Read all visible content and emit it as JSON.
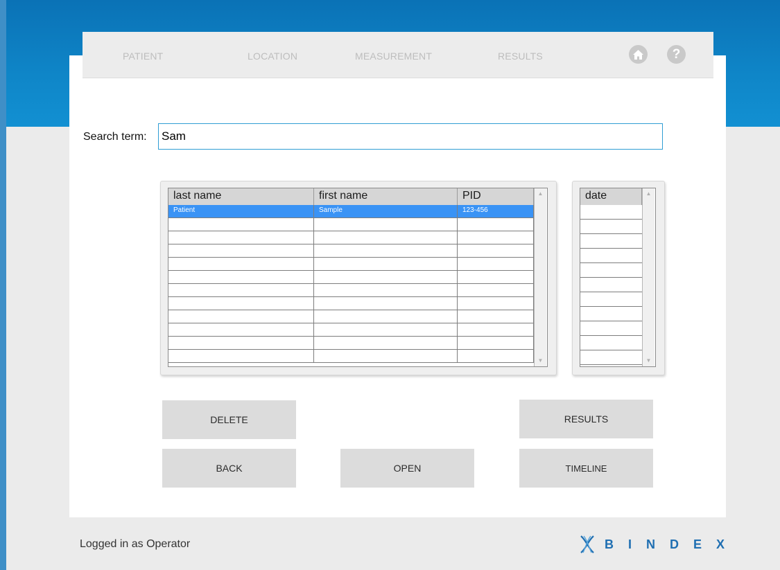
{
  "nav": {
    "items": [
      "PATIENT",
      "LOCATION",
      "MEASUREMENT",
      "RESULTS"
    ],
    "home_icon": "home-icon",
    "help_icon": "help-icon"
  },
  "search": {
    "label": "Search term:",
    "value": "Sam"
  },
  "patients": {
    "columns": [
      "last name",
      "first name",
      "PID"
    ],
    "rows": [
      [
        "Patient",
        "Sample",
        "123-456"
      ]
    ]
  },
  "dates": {
    "columns": [
      "date"
    ]
  },
  "buttons": {
    "delete": "DELETE",
    "results": "RESULTS",
    "back": "BACK",
    "open": "OPEN",
    "timeline": "TIMELINE"
  },
  "footer": {
    "status": "Logged in as Operator",
    "brand": "BINDEX"
  },
  "colors": {
    "accent": "#0f86c8",
    "selection": "#3a93f5",
    "brand": "#1f6fb2"
  }
}
